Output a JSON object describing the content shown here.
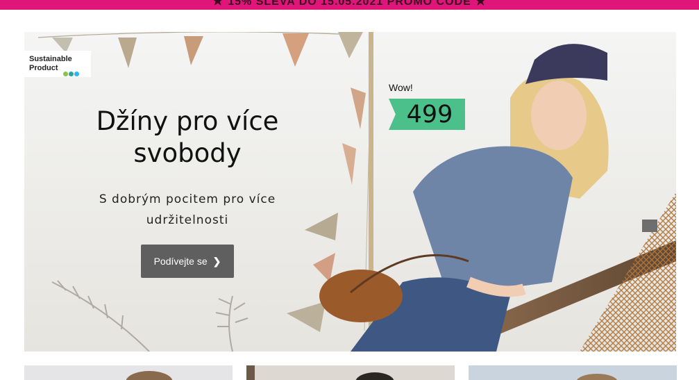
{
  "promo": {
    "text": "15% SLEVA DO 15.05.2021 PROMO CODE",
    "star_color": "#3a0a1e",
    "background": "#e0157a"
  },
  "hero": {
    "badge": {
      "line1": "Sustainable",
      "line2": "Product",
      "dot_colors": [
        "#8bc34a",
        "#26a69a",
        "#29b6f6"
      ]
    },
    "headline": "Džíny pro více svobody",
    "headline_line1": "Džíny pro více",
    "headline_line2": "svobody",
    "subline_line1": "S dobrým pocitem pro více",
    "subline_line2": "udržitelnosti",
    "cta_label": "Podívejte se",
    "cta_icon": "chevron-right-icon",
    "price": {
      "label": "Wow!",
      "value": "499",
      "color": "#4cc08b"
    }
  },
  "tiles": [
    {
      "name": "category-tile-1"
    },
    {
      "name": "category-tile-2"
    },
    {
      "name": "category-tile-3"
    }
  ]
}
